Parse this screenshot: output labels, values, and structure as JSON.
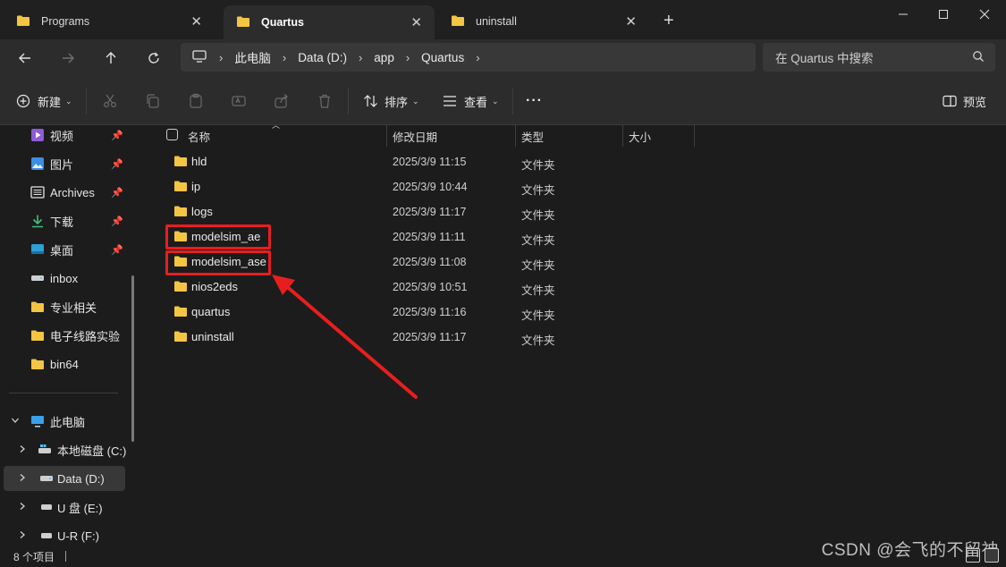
{
  "tabs": [
    {
      "label": "Programs",
      "active": false
    },
    {
      "label": "Quartus",
      "active": true
    },
    {
      "label": "uninstall",
      "active": false
    }
  ],
  "address": {
    "crumbs": [
      "此电脑",
      "Data (D:)",
      "app",
      "Quartus"
    ]
  },
  "search": {
    "placeholder": "在 Quartus 中搜索"
  },
  "toolbar": {
    "new_label": "新建",
    "sort_label": "排序",
    "view_label": "查看",
    "more_label": "···",
    "preview_label": "预览"
  },
  "sidebar": {
    "quick": [
      {
        "label": "视频",
        "icon": "video-icon",
        "pinned": true
      },
      {
        "label": "图片",
        "icon": "image-icon",
        "pinned": true
      },
      {
        "label": "Archives",
        "icon": "document-icon",
        "pinned": true
      },
      {
        "label": "下载",
        "icon": "download-icon",
        "pinned": true
      },
      {
        "label": "桌面",
        "icon": "desktop-icon",
        "pinned": true
      },
      {
        "label": "inbox",
        "icon": "drive-icon",
        "pinned": false
      },
      {
        "label": "专业相关",
        "icon": "folder-icon",
        "pinned": false
      },
      {
        "label": "电子线路实验",
        "icon": "folder-icon",
        "pinned": false
      },
      {
        "label": "bin64",
        "icon": "folder-icon",
        "pinned": false
      }
    ],
    "this_pc": {
      "label": "此电脑"
    },
    "drives": [
      {
        "label": "本地磁盘 (C:)",
        "icon": "windows-drive-icon",
        "selected": false
      },
      {
        "label": "Data (D:)",
        "icon": "drive-icon",
        "selected": true
      },
      {
        "label": "U 盘 (E:)",
        "icon": "usb-drive-icon",
        "selected": false
      },
      {
        "label": "U-R (F:)",
        "icon": "usb-drive-icon",
        "selected": false
      }
    ]
  },
  "columns": {
    "name": "名称",
    "date": "修改日期",
    "type": "类型",
    "size": "大小"
  },
  "files": [
    {
      "name": "hld",
      "date": "2025/3/9 11:15",
      "type": "文件夹",
      "highlighted": false
    },
    {
      "name": "ip",
      "date": "2025/3/9 10:44",
      "type": "文件夹",
      "highlighted": false
    },
    {
      "name": "logs",
      "date": "2025/3/9 11:17",
      "type": "文件夹",
      "highlighted": false
    },
    {
      "name": "modelsim_ae",
      "date": "2025/3/9 11:11",
      "type": "文件夹",
      "highlighted": true
    },
    {
      "name": "modelsim_ase",
      "date": "2025/3/9 11:08",
      "type": "文件夹",
      "highlighted": true
    },
    {
      "name": "nios2eds",
      "date": "2025/3/9 10:51",
      "type": "文件夹",
      "highlighted": false
    },
    {
      "name": "quartus",
      "date": "2025/3/9 11:16",
      "type": "文件夹",
      "highlighted": false
    },
    {
      "name": "uninstall",
      "date": "2025/3/9 11:17",
      "type": "文件夹",
      "highlighted": false
    }
  ],
  "status": {
    "count_text": "8 个项目"
  },
  "watermark": "CSDN @会飞的不留神",
  "colors": {
    "folder": "#f4c542",
    "annotation": "#e81e1e",
    "accent": "#4cc2ff"
  }
}
